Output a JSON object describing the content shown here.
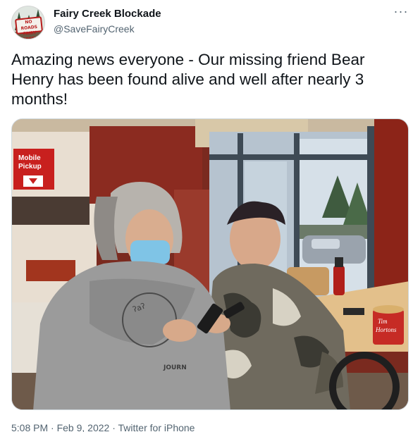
{
  "author": {
    "display_name": "Fairy Creek Blockade",
    "handle": "@SaveFairyCreek",
    "avatar_sign_text": "NO ROADS IN FAIRY CREEK"
  },
  "menu": {
    "more_icon": "more-horizontal-icon",
    "more_label": "···"
  },
  "tweet": {
    "text": "Amazing news everyone - Our missing friend Bear Henry has been found alive and well after nearly 3 months!"
  },
  "photo": {
    "store_sign": "Mobile\nPickup",
    "cup_brand": "Tim\nHortons",
    "hoodie_text": "JOURN"
  },
  "meta": {
    "time": "5:08 PM",
    "separator": "·",
    "date": "Feb 9, 2022",
    "source": "Twitter for iPhone"
  },
  "colors": {
    "text_primary": "#0f1419",
    "text_secondary": "#536471",
    "brand_red": "#b71c1c"
  }
}
